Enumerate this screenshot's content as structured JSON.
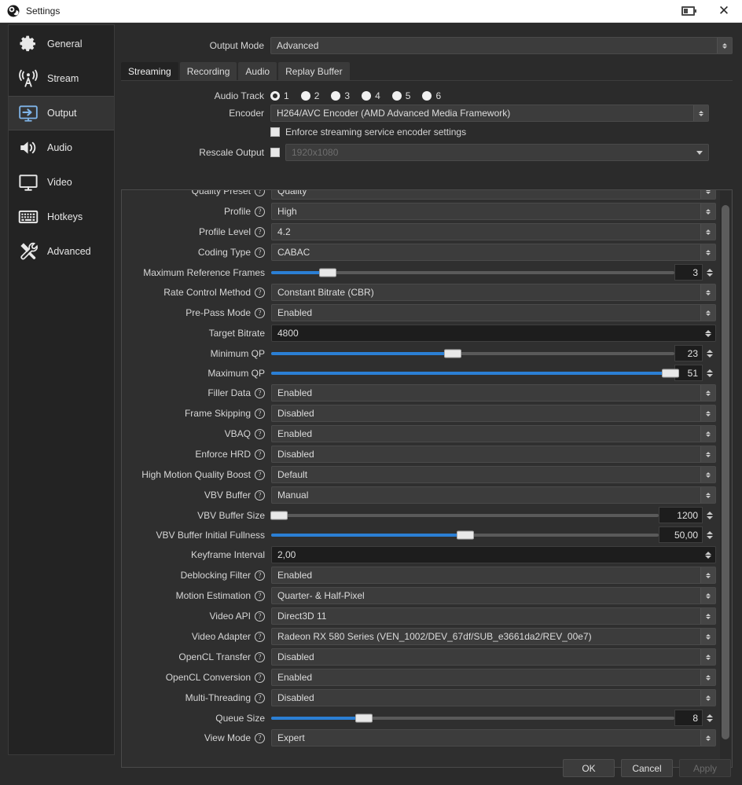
{
  "window": {
    "title": "Settings",
    "icon": "obs-logo-icon",
    "restore_icon": "restore-window-icon",
    "close_icon": "close-icon"
  },
  "sidebar": {
    "items": [
      {
        "label": "General",
        "icon": "gear-icon",
        "active": false
      },
      {
        "label": "Stream",
        "icon": "broadcast-icon",
        "active": false
      },
      {
        "label": "Output",
        "icon": "output-monitor-icon",
        "active": true
      },
      {
        "label": "Audio",
        "icon": "speaker-icon",
        "active": false
      },
      {
        "label": "Video",
        "icon": "monitor-icon",
        "active": false
      },
      {
        "label": "Hotkeys",
        "icon": "keyboard-icon",
        "active": false
      },
      {
        "label": "Advanced",
        "icon": "tools-icon",
        "active": false
      }
    ]
  },
  "output_mode": {
    "label": "Output Mode",
    "value": "Advanced"
  },
  "tabs": [
    {
      "label": "Streaming",
      "active": true
    },
    {
      "label": "Recording",
      "active": false
    },
    {
      "label": "Audio",
      "active": false
    },
    {
      "label": "Replay Buffer",
      "active": false
    }
  ],
  "audio_track": {
    "label": "Audio Track",
    "options": [
      "1",
      "2",
      "3",
      "4",
      "5",
      "6"
    ],
    "selected": "1"
  },
  "encoder": {
    "label": "Encoder",
    "value": "H264/AVC Encoder (AMD Advanced Media Framework)"
  },
  "enforce": {
    "label": "Enforce streaming service encoder settings",
    "checked": false
  },
  "rescale": {
    "label": "Rescale Output",
    "checked": false,
    "value": "1920x1080"
  },
  "settings_rows": [
    {
      "label": "Quality Preset",
      "help": true,
      "type": "combo",
      "value": "Quality"
    },
    {
      "label": "Profile",
      "help": true,
      "type": "combo",
      "value": "High"
    },
    {
      "label": "Profile Level",
      "help": true,
      "type": "combo",
      "value": "4.2"
    },
    {
      "label": "Coding Type",
      "help": true,
      "type": "combo",
      "value": "CABAC"
    },
    {
      "label": "Maximum Reference Frames",
      "help": false,
      "type": "slider",
      "value": "3",
      "percent": 14
    },
    {
      "label": "Rate Control Method",
      "help": true,
      "type": "combo",
      "value": "Constant Bitrate (CBR)"
    },
    {
      "label": "Pre-Pass Mode",
      "help": true,
      "type": "combo",
      "value": "Enabled"
    },
    {
      "label": "Target Bitrate",
      "help": false,
      "type": "number",
      "value": "4800"
    },
    {
      "label": "Minimum QP",
      "help": false,
      "type": "slider",
      "value": "23",
      "percent": 45
    },
    {
      "label": "Maximum QP",
      "help": false,
      "type": "slider",
      "value": "51",
      "percent": 99
    },
    {
      "label": "Filler Data",
      "help": true,
      "type": "combo",
      "value": "Enabled"
    },
    {
      "label": "Frame Skipping",
      "help": true,
      "type": "combo",
      "value": "Disabled"
    },
    {
      "label": "VBAQ",
      "help": true,
      "type": "combo",
      "value": "Enabled"
    },
    {
      "label": "Enforce HRD",
      "help": true,
      "type": "combo",
      "value": "Disabled"
    },
    {
      "label": "High Motion Quality Boost",
      "help": true,
      "type": "combo",
      "value": "Default"
    },
    {
      "label": "VBV Buffer",
      "help": true,
      "type": "combo",
      "value": "Manual"
    },
    {
      "label": "VBV Buffer Size",
      "help": false,
      "type": "slider-wide",
      "value": "1200",
      "percent": 2
    },
    {
      "label": "VBV Buffer Initial Fullness",
      "help": false,
      "type": "slider-wide",
      "value": "50,00",
      "percent": 50
    },
    {
      "label": "Keyframe Interval",
      "help": false,
      "type": "number",
      "value": "2,00"
    },
    {
      "label": "Deblocking Filter",
      "help": true,
      "type": "combo",
      "value": "Enabled"
    },
    {
      "label": "Motion Estimation",
      "help": true,
      "type": "combo",
      "value": "Quarter- & Half-Pixel"
    },
    {
      "label": "Video API",
      "help": true,
      "type": "combo",
      "value": "Direct3D 11"
    },
    {
      "label": "Video Adapter",
      "help": true,
      "type": "combo",
      "value": "Radeon RX 580 Series (VEN_1002/DEV_67df/SUB_e3661da2/REV_00e7)"
    },
    {
      "label": "OpenCL Transfer",
      "help": true,
      "type": "combo",
      "value": "Disabled"
    },
    {
      "label": "OpenCL Conversion",
      "help": true,
      "type": "combo",
      "value": "Enabled"
    },
    {
      "label": "Multi-Threading",
      "help": true,
      "type": "combo",
      "value": "Disabled"
    },
    {
      "label": "Queue Size",
      "help": false,
      "type": "slider",
      "value": "8",
      "percent": 23
    },
    {
      "label": "View Mode",
      "help": true,
      "type": "combo",
      "value": "Expert"
    }
  ],
  "footer": {
    "ok": "OK",
    "cancel": "Cancel",
    "apply": "Apply",
    "apply_enabled": false
  },
  "colors": {
    "accent": "#2b7fd4",
    "window_bg": "#2b2b2b",
    "panel_bg": "#2f2f2f",
    "sidebar_bg": "#232323",
    "titlebar_bg": "#ffffff"
  }
}
